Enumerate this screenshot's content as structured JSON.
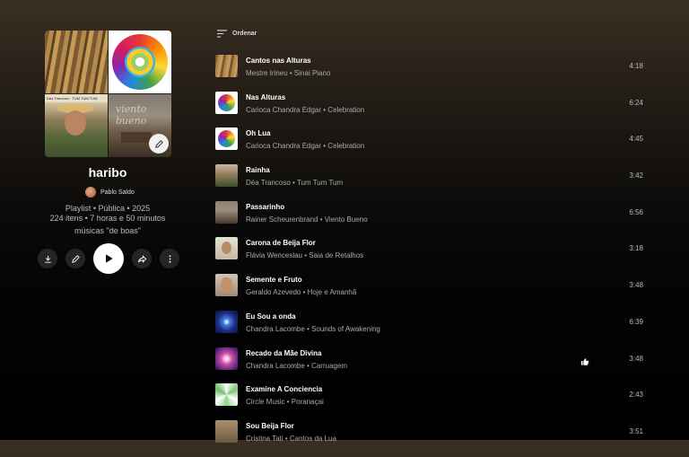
{
  "playlist": {
    "title": "haribo",
    "owner": "Pablo Saldo",
    "type_line": "Playlist • Pública • 2025",
    "stats_line": "224 itens • 7 horas e 50 minutos",
    "description": "músicas \"de boas\"",
    "collage_text": {
      "tile3_caption": "Déa Trancoso · TUM TUM TUM",
      "tile4_caption": "viento bueno"
    }
  },
  "actions": {
    "download_icon": "download-icon",
    "edit_icon": "pencil-icon",
    "play_icon": "play-icon",
    "share_icon": "share-icon",
    "more_icon": "more-vertical-icon"
  },
  "sort": {
    "label": "Ordenar",
    "icon": "sort-icon"
  },
  "tracks": [
    {
      "title": "Cantos nas Alturas",
      "subtitle": "Mestre Irineu • Sinai Piano",
      "duration": "4:18",
      "liked": false
    },
    {
      "title": "Nas Alturas",
      "subtitle": "Carioca Chandra Edgar • Celebration",
      "duration": "6:24",
      "liked": false
    },
    {
      "title": "Oh Lua",
      "subtitle": "Carioca Chandra Edgar • Celebration",
      "duration": "4:45",
      "liked": false
    },
    {
      "title": "Rainha",
      "subtitle": "Déa Trancoso • Tum Tum Tum",
      "duration": "3:42",
      "liked": false
    },
    {
      "title": "Passarinho",
      "subtitle": "Rainer Scheurenbrand • Viento Bueno",
      "duration": "6:56",
      "liked": false
    },
    {
      "title": "Carona de Beija Flor",
      "subtitle": "Flávia Wenceslau • Saia de Retalhos",
      "duration": "3:18",
      "liked": false
    },
    {
      "title": "Semente e Fruto",
      "subtitle": "Geraldo Azevedo • Hoje e Amanhã",
      "duration": "3:48",
      "liked": false
    },
    {
      "title": "Eu Sou a onda",
      "subtitle": "Chandra Lacombe • Sounds of Awakening",
      "duration": "6:39",
      "liked": false
    },
    {
      "title": "Recado da Mãe Divina",
      "subtitle": "Chandra Lacombe • Carruagem",
      "duration": "3:48",
      "liked": true
    },
    {
      "title": "Examine A Conciencia",
      "subtitle": "Circle Music • Poranaçai",
      "duration": "2:43",
      "liked": false
    },
    {
      "title": "Sou Beija Flor",
      "subtitle": "Cristina Tati • Cantos da Lua",
      "duration": "3:51",
      "liked": false
    }
  ],
  "colors": {
    "background_top": "#3a2f22",
    "background_bottom": "#000000",
    "text_primary": "#ffffff",
    "text_secondary": "#aaaaaa"
  }
}
